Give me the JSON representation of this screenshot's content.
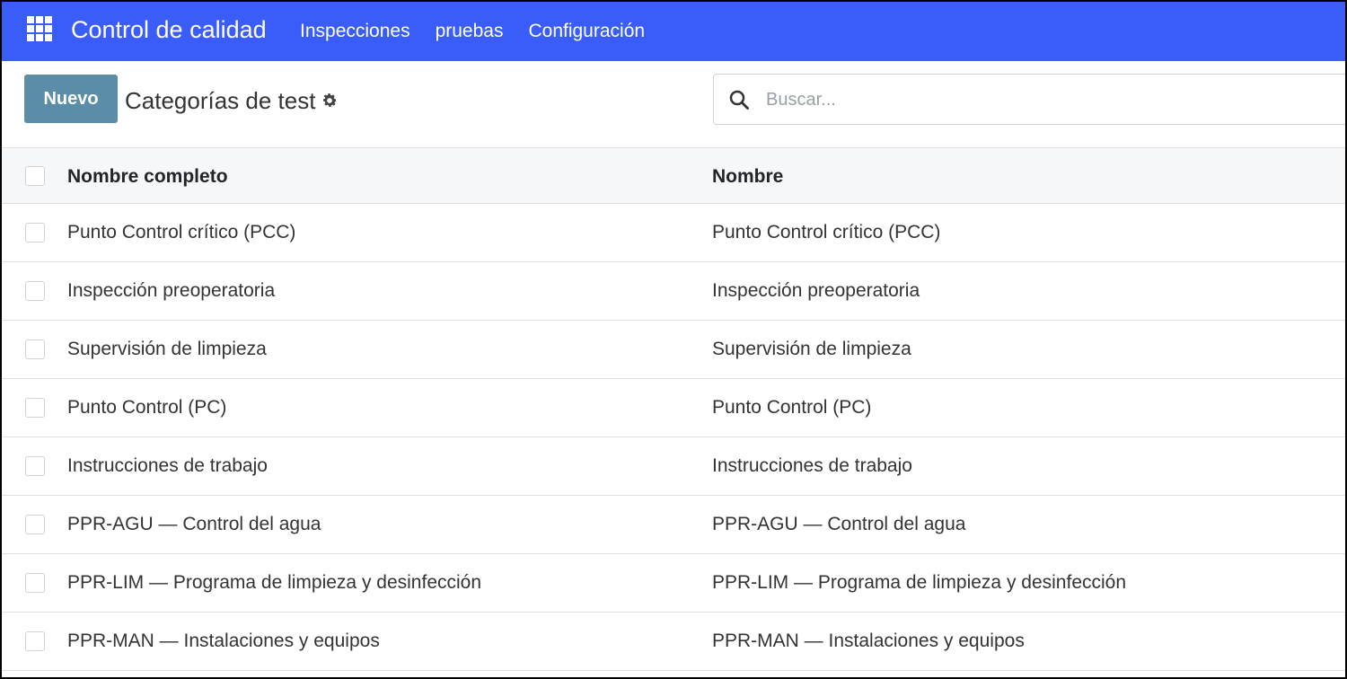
{
  "navbar": {
    "brand": "Control de calidad",
    "menu": [
      {
        "label": "Inspecciones"
      },
      {
        "label": "pruebas"
      },
      {
        "label": "Configuración"
      }
    ],
    "color": "#3a5dfa"
  },
  "control": {
    "new_label": "Nuevo",
    "title": "Categorías de test",
    "search_placeholder": "Buscar..."
  },
  "table": {
    "columns": [
      "Nombre completo",
      "Nombre"
    ],
    "rows": [
      [
        "Punto Control crítico (PCC)",
        "Punto Control crítico (PCC)"
      ],
      [
        "Inspección preoperatoria",
        "Inspección preoperatoria"
      ],
      [
        "Supervisión de limpieza",
        "Supervisión de limpieza"
      ],
      [
        "Punto Control (PC)",
        "Punto Control (PC)"
      ],
      [
        "Instrucciones de trabajo",
        "Instrucciones de trabajo"
      ],
      [
        "PPR-AGU — Control del agua",
        "PPR-AGU — Control del agua"
      ],
      [
        "PPR-LIM — Programa de limpieza y desinfección",
        "PPR-LIM — Programa de limpieza y desinfección"
      ],
      [
        "PPR-MAN — Instalaciones y equipos",
        "PPR-MAN — Instalaciones y equipos"
      ]
    ]
  },
  "icons": {
    "apps": "apps-grid-icon",
    "gear": "gear-icon",
    "search": "search-icon"
  }
}
